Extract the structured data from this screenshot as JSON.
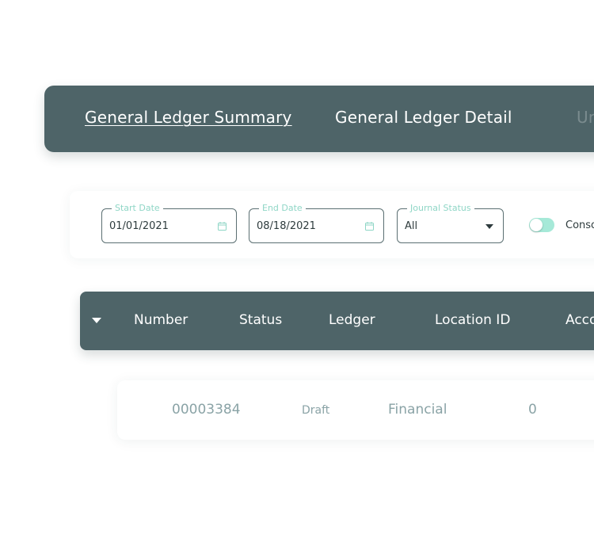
{
  "tabs": [
    {
      "label": "General Ledger Summary",
      "active": true
    },
    {
      "label": "General Ledger Detail",
      "active": false
    },
    {
      "label": "Un",
      "active": false
    }
  ],
  "filters": {
    "start_date": {
      "label": "Start Date",
      "value": "01/01/2021"
    },
    "end_date": {
      "label": "End Date",
      "value": "08/18/2021"
    },
    "journal_status": {
      "label": "Journal Status",
      "value": "All"
    },
    "consolidate": {
      "label": "Conso",
      "on": true
    }
  },
  "table": {
    "columns": [
      "Number",
      "Status",
      "Ledger",
      "Location ID",
      "Acco"
    ],
    "rows": [
      {
        "number": "00003384",
        "status": "Draft",
        "ledger": "Financial",
        "location_id": "0"
      }
    ]
  },
  "colors": {
    "header_bg": "#4e6468",
    "accent": "#8fd6c6",
    "toggle_on": "#a6e9d8",
    "row_text": "#8aa3a6"
  },
  "icons": {
    "date_picker": "calendar-icon",
    "dropdown": "caret-down-icon",
    "expand": "caret-down-icon"
  }
}
